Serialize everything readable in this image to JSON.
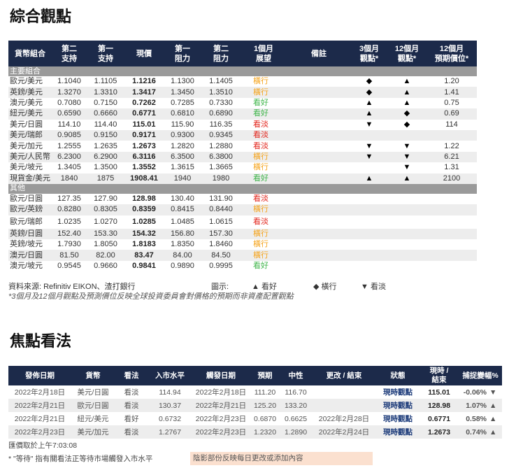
{
  "section1_title": "綜合觀點",
  "section2_title": "焦點看法",
  "table1": {
    "headers": [
      "貨幣組合",
      "第二\n支持",
      "第一\n支持",
      "現價",
      "第一\n阻力",
      "第二\n阻力",
      "1個月\n展望",
      "備註",
      "3個月\n觀點*",
      "12個月\n觀點*",
      "12個月\n預期價位*"
    ],
    "group1": "主要組合",
    "group2": "其他",
    "rows1": [
      {
        "pair": "歐元/美元",
        "s2": "1.1040",
        "s1": "1.1105",
        "now": "1.1216",
        "r1": "1.1300",
        "r2": "1.1405",
        "view": "橫行",
        "vc": "orange",
        "m3": "◆",
        "m12": "▲",
        "p12": "1.20"
      },
      {
        "pair": "英鎊/美元",
        "s2": "1.3270",
        "s1": "1.3310",
        "now": "1.3417",
        "r1": "1.3450",
        "r2": "1.3510",
        "view": "橫行",
        "vc": "orange",
        "m3": "◆",
        "m12": "▲",
        "p12": "1.41"
      },
      {
        "pair": "澳元/美元",
        "s2": "0.7080",
        "s1": "0.7150",
        "now": "0.7262",
        "r1": "0.7285",
        "r2": "0.7330",
        "view": "看好",
        "vc": "green",
        "m3": "▲",
        "m12": "▲",
        "p12": "0.75"
      },
      {
        "pair": "紐元/美元",
        "s2": "0.6590",
        "s1": "0.6660",
        "now": "0.6771",
        "r1": "0.6810",
        "r2": "0.6890",
        "view": "看好",
        "vc": "green",
        "m3": "▲",
        "m12": "◆",
        "p12": "0.69"
      },
      {
        "pair": "美元/日圓",
        "s2": "114.10",
        "s1": "114.40",
        "now": "115.01",
        "r1": "115.90",
        "r2": "116.35",
        "view": "看淡",
        "vc": "red",
        "m3": "▼",
        "m12": "◆",
        "p12": "114"
      },
      {
        "pair": "美元/瑞郎",
        "s2": "0.9085",
        "s1": "0.9150",
        "now": "0.9171",
        "r1": "0.9300",
        "r2": "0.9345",
        "view": "看淡",
        "vc": "red",
        "m3": "",
        "m12": "",
        "p12": ""
      },
      {
        "pair": "美元/加元",
        "s2": "1.2555",
        "s1": "1.2635",
        "now": "1.2673",
        "r1": "1.2820",
        "r2": "1.2880",
        "view": "看淡",
        "vc": "red",
        "m3": "▼",
        "m12": "▼",
        "p12": "1.22"
      },
      {
        "pair": "美元/人民幣",
        "s2": "6.2300",
        "s1": "6.2900",
        "now": "6.3116",
        "r1": "6.3500",
        "r2": "6.3800",
        "view": "橫行",
        "vc": "orange",
        "m3": "▼",
        "m12": "▼",
        "p12": "6.21"
      },
      {
        "pair": "美元/坡元",
        "s2": "1.3405",
        "s1": "1.3500",
        "now": "1.3552",
        "r1": "1.3615",
        "r2": "1.3665",
        "view": "橫行",
        "vc": "orange",
        "m3": "",
        "m12": "▼",
        "p12": "1.31"
      },
      {
        "pair": "現貨金/美元",
        "s2": "1840",
        "s1": "1875",
        "now": "1908.41",
        "r1": "1940",
        "r2": "1980",
        "view": "看好",
        "vc": "green",
        "m3": "▲",
        "m12": "▲",
        "p12": "2100"
      }
    ],
    "rows2": [
      {
        "pair": "歐元/日圓",
        "s2": "127.35",
        "s1": "127.90",
        "now": "128.98",
        "r1": "130.40",
        "r2": "131.90",
        "view": "看淡",
        "vc": "red"
      },
      {
        "pair": "歐元/英鎊",
        "s2": "0.8280",
        "s1": "0.8305",
        "now": "0.8359",
        "r1": "0.8415",
        "r2": "0.8440",
        "view": "橫行",
        "vc": "orange"
      },
      {
        "pair": "歐元/瑞郎",
        "s2": "1.0235",
        "s1": "1.0270",
        "now": "1.0285",
        "r1": "1.0485",
        "r2": "1.0615",
        "view": "看淡",
        "vc": "red",
        "tall": true
      },
      {
        "pair": "英鎊/日圓",
        "s2": "152.40",
        "s1": "153.30",
        "now": "154.32",
        "r1": "156.80",
        "r2": "157.30",
        "view": "橫行",
        "vc": "orange"
      },
      {
        "pair": "英鎊/坡元",
        "s2": "1.7930",
        "s1": "1.8050",
        "now": "1.8183",
        "r1": "1.8350",
        "r2": "1.8460",
        "view": "橫行",
        "vc": "orange"
      },
      {
        "pair": "澳元/日圓",
        "s2": "81.50",
        "s1": "82.00",
        "now": "83.47",
        "r1": "84.00",
        "r2": "84.50",
        "view": "橫行",
        "vc": "orange"
      },
      {
        "pair": "澳元/坡元",
        "s2": "0.9545",
        "s1": "0.9660",
        "now": "0.9841",
        "r1": "0.9890",
        "r2": "0.9995",
        "view": "看好",
        "vc": "green"
      }
    ],
    "source": "資料來源: Refinitiv EIKON、渣打銀行",
    "legend_label": "圖示:",
    "legend_up": "▲ 看好",
    "legend_side": "◆ 橫行",
    "legend_down": "▼ 看淡",
    "note": "*3個月及12個月觀點及預測價位反映全球投資委員會對價格的預期而非資產配置觀點"
  },
  "table2": {
    "headers": [
      "發佈日期",
      "貨幣",
      "看法",
      "入市水平",
      "觸發日期",
      "預期",
      "中性",
      "更改 / 結束",
      "狀態",
      "現時 /\n結束",
      "捕捉變幅%"
    ],
    "rows": [
      {
        "date": "2022年2月18日",
        "pair": "美元/日圓",
        "view": "看淡",
        "vc": "red",
        "entry": "114.94",
        "trig": "2022年2月18日",
        "exp": "111.20",
        "neu": "116.70",
        "chg_date": "",
        "status": "現時觀點",
        "now": "115.01",
        "pct": "-0.06%",
        "pc": "neg",
        "arrow": "▼",
        "ac": "arr-red"
      },
      {
        "date": "2022年2月21日",
        "pair": "歐元/日圓",
        "view": "看淡",
        "vc": "red",
        "entry": "130.37",
        "trig": "2022年2月21日",
        "exp": "125.20",
        "neu": "133.20",
        "chg_date": "",
        "status": "現時觀點",
        "now": "128.98",
        "pct": "1.07%",
        "pc": "pos",
        "arrow": "▲",
        "ac": "arr-green"
      },
      {
        "date": "2022年2月21日",
        "pair": "紐元/美元",
        "view": "看好",
        "vc": "green",
        "entry": "0.6732",
        "trig": "2022年2月23日",
        "exp": "0.6870",
        "neu": "0.6625",
        "chg_date": "2022年2月28日",
        "status": "現時觀點",
        "now": "0.6771",
        "pct": "0.58%",
        "pc": "pos",
        "arrow": "▲",
        "ac": "arr-green"
      },
      {
        "date": "2022年2月23日",
        "pair": "美元/加元",
        "view": "看淡",
        "vc": "red",
        "entry": "1.2767",
        "trig": "2022年2月23日",
        "exp": "1.2320",
        "neu": "1.2890",
        "chg_date": "2022年2月24日",
        "status": "現時觀點",
        "now": "1.2673",
        "pct": "0.74%",
        "pc": "pos",
        "arrow": "▲",
        "ac": "arr-green"
      }
    ],
    "price_time": "匯價取於上午7:03:08",
    "footnote": "* \"等待\" 指有關看法正等待市場觸發入市水平",
    "shade_note": "陰影部份反映每日更改或添加內容"
  }
}
